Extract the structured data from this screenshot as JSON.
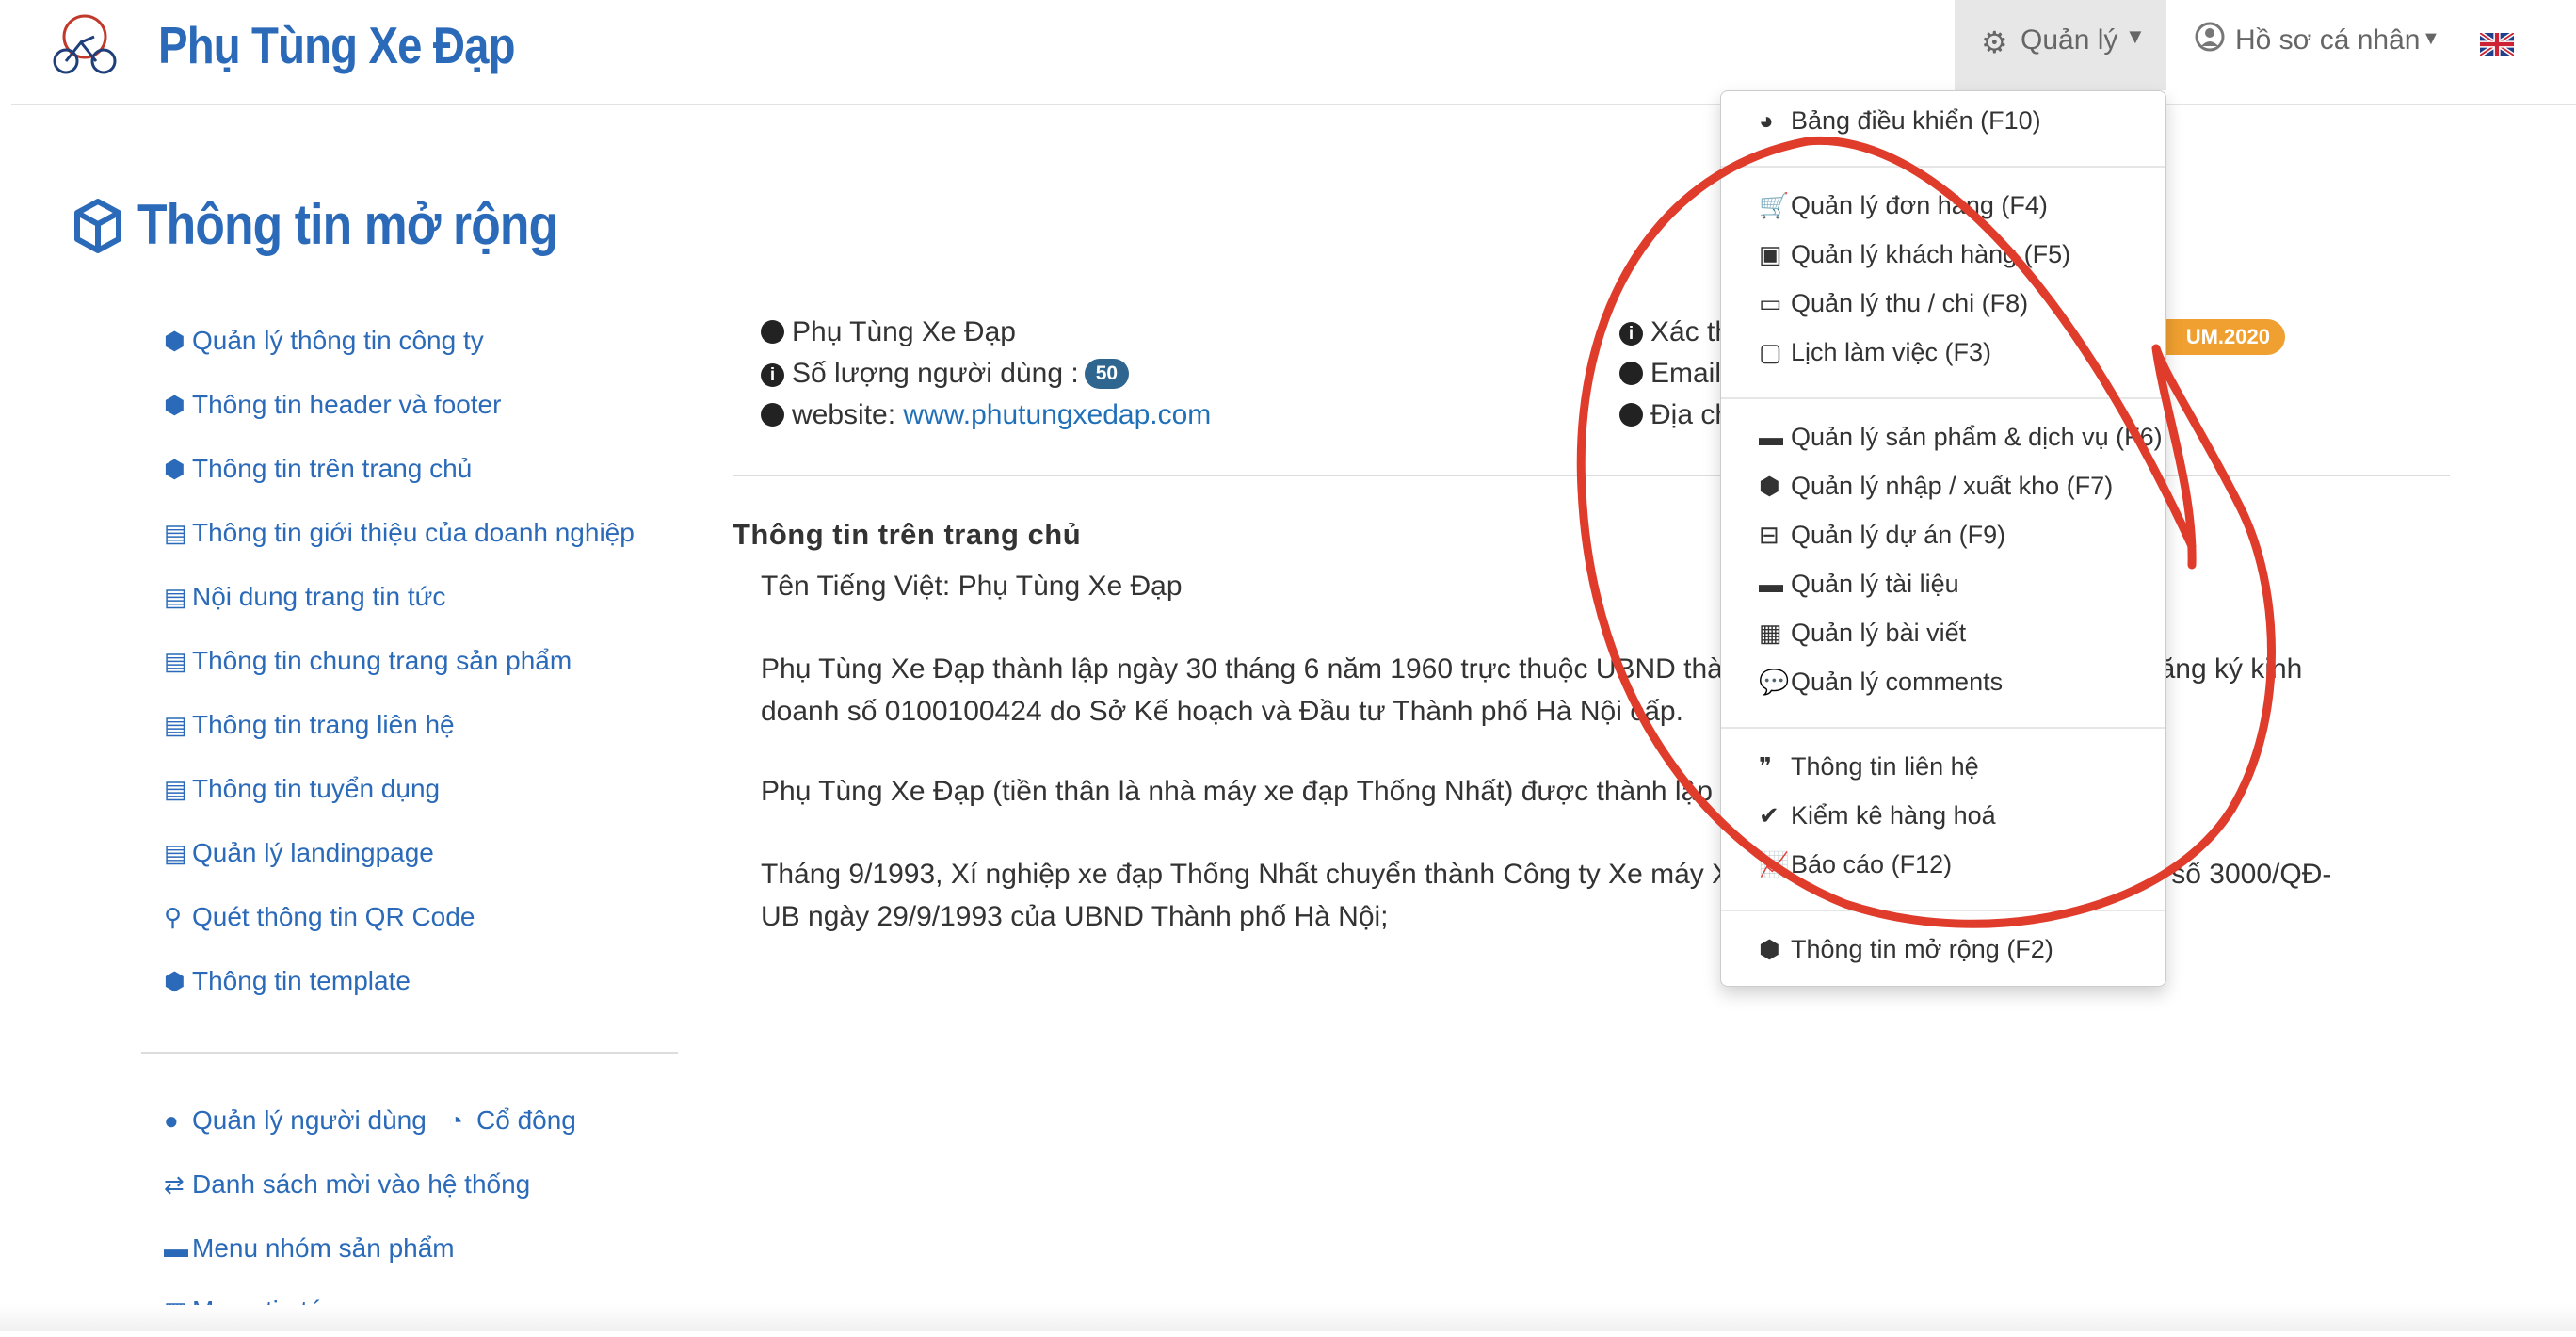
{
  "header": {
    "brand": "Phụ Tùng Xe Đạp",
    "nav_manage_label": "Quản lý",
    "nav_profile_label": "Hồ sơ cá nhân",
    "manage_icon": "gears-icon",
    "profile_icon": "user-circle-icon",
    "flag_icon": "uk-flag-icon"
  },
  "page": {
    "title": "Thông tin mở rộng",
    "title_icon": "cube-icon"
  },
  "sidebar": {
    "items": [
      {
        "label": "Quản lý thông tin công ty",
        "icon": "cube-icon"
      },
      {
        "label": "Thông tin header và footer",
        "icon": "cube-icon"
      },
      {
        "label": "Thông tin trên trang chủ",
        "icon": "cube-icon"
      },
      {
        "label": "Thông tin giới thiệu của doanh nghiệp",
        "icon": "file-text-icon"
      },
      {
        "label": "Nội dung trang tin tức",
        "icon": "file-text-icon"
      },
      {
        "label": "Thông tin chung trang sản phẩm",
        "icon": "file-text-icon"
      },
      {
        "label": "Thông tin trang liên hệ",
        "icon": "file-text-icon"
      },
      {
        "label": "Thông tin tuyển dụng",
        "icon": "file-text-icon"
      },
      {
        "label": "Quản lý landingpage",
        "icon": "file-text-icon"
      },
      {
        "label": "Quét thông tin QR Code",
        "icon": "search-icon"
      },
      {
        "label": "Thông tin template",
        "icon": "cube-icon"
      }
    ],
    "bottom_items": [
      {
        "label": "Quản lý người dùng",
        "icon": "user-icon"
      },
      {
        "label": "Cổ đông",
        "icon": "pie-chart-icon"
      },
      {
        "label": "Danh sách mời vào hệ thống",
        "icon": "retweet-icon"
      },
      {
        "label": "Menu nhóm sản phẩm",
        "icon": "folder-icon"
      },
      {
        "label": "Menu tin tức",
        "icon": "newspaper-icon"
      }
    ]
  },
  "info": {
    "company_name": "Phụ Tùng Xe Đạp",
    "users_label": "Số lượng người dùng :",
    "users_count": "50",
    "website_label": "website:",
    "website_url": "www.phutungxedap.com",
    "verify_label": "Xác th",
    "email_label": "Email:",
    "address_label": "Địa ch",
    "plan_badge": "UM.2020"
  },
  "content": {
    "heading": "Thông tin trên trang chủ",
    "vn_name": "Tên Tiếng Việt: Phụ Tùng Xe Đạp",
    "p1": "Phụ Tùng Xe Đạp thành lập ngày 30 tháng 6 năm 1960 trực thuộc UBND thành phố Hà Nội, Giấy chứng nhận đăng ký kinh doanh số 0100100424 do Sở Kế hoạch và Đầu tư Thành phố Hà Nội cấp.",
    "p2": "Phụ Tùng Xe Đạp (tiền thân là nhà máy xe đạp Thống Nhất) được thành lập ngày",
    "p3": "Tháng 9/1993, Xí nghiệp xe đạp Thống Nhất chuyển thành Công ty Xe máy Xe đạp Thống Nhất theo Quyết định số 3000/QĐ-UB ngày 29/9/1993 của UBND Thành phố Hà Nội;"
  },
  "dropdown": {
    "items": [
      {
        "label": "Bảng điều khiển (F10)",
        "icon": "dashboard-icon"
      },
      {
        "label": "Quản lý đơn hàng (F4)",
        "icon": "cart-icon"
      },
      {
        "label": "Quản lý khách hàng (F5)",
        "icon": "address-card-icon"
      },
      {
        "label": "Quản lý thu / chi (F8)",
        "icon": "money-icon"
      },
      {
        "label": "Lịch làm việc (F3)",
        "icon": "calendar-icon"
      },
      {
        "label": "Quản lý sản phẩm & dịch vụ (F6)",
        "icon": "folder-icon"
      },
      {
        "label": "Quản lý nhập / xuất kho (F7)",
        "icon": "cubes-icon"
      },
      {
        "label": "Quản lý dự án (F9)",
        "icon": "hdd-icon"
      },
      {
        "label": "Quản lý tài liệu",
        "icon": "folder-icon"
      },
      {
        "label": "Quản lý bài viết",
        "icon": "newspaper-icon"
      },
      {
        "label": "Quản lý comments",
        "icon": "comments-icon"
      },
      {
        "label": "Thông tin liên hệ",
        "icon": "quote-icon"
      },
      {
        "label": "Kiểm kê hàng hoá",
        "icon": "check-icon"
      },
      {
        "label": "Báo cáo (F12)",
        "icon": "line-chart-icon"
      },
      {
        "label": "Thông tin mở rộng (F2)",
        "icon": "cube-icon"
      }
    ]
  },
  "colors": {
    "brand_blue": "#2a6ab8",
    "annotation_red": "#e03c2c",
    "badge_orange": "#f0a030",
    "badge_blue": "#2f6690"
  }
}
